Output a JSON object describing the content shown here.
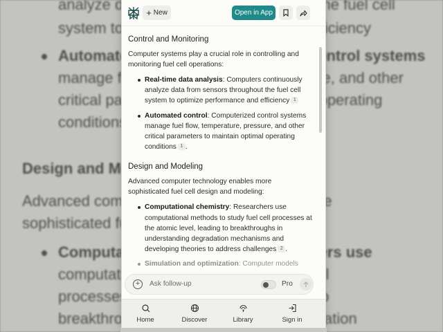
{
  "background": {
    "lines": [
      "analyze data from sensors throughout the fuel cell",
      "system to optimize performance and efficiency",
      "Automated control: Computerized control systems",
      "manage fuel flow, temperature, pressure, and other",
      "critical parameters to maintain optimal operating",
      "conditions",
      "Design and Modeling",
      "Advanced computer technology enables more",
      "sophisticated fuel cell design and modeling:",
      "Computational chemistry: Researchers use",
      "computational methods to study fuel cell",
      "processes at the atomic level, leading to",
      "breakthroughs in understanding degradation"
    ]
  },
  "header": {
    "logo_icon": "perplexity-logo-icon",
    "new_label": "New",
    "open_app_label": "Open in App",
    "bookmark_icon": "bookmark-icon",
    "share_icon": "share-icon"
  },
  "sections": [
    {
      "title": "Control and Monitoring",
      "lead": "Computer systems play a crucial role in controlling and monitoring fuel cell operations:",
      "items": [
        {
          "term": "Real-time data analysis",
          "text": ": Computers continuously analyze data from sensors throughout the fuel cell system to optimize performance and efficiency",
          "cite": "1"
        },
        {
          "term": "Automated control",
          "text": ": Computerized control systems manage fuel flow, temperature, pressure, and other critical parameters to maintain optimal operating conditions",
          "cite": "1",
          "trail": "."
        }
      ]
    },
    {
      "title": "Design and Modeling",
      "lead": "Advanced computer technology enables more sophisticated fuel cell design and modeling:",
      "items": [
        {
          "term": "Computational chemistry",
          "text": ": Researchers use computational methods to study fuel cell processes at the atomic level, leading to breakthroughs in understanding degradation mechanisms and developing theories to address challenges",
          "cite": "2",
          "trail": "."
        },
        {
          "term": "Simulation and optimization",
          "text": ": Computer models",
          "cite": "",
          "trail": ""
        }
      ]
    }
  ],
  "composer": {
    "placeholder": "Ask follow-up",
    "pro_label": "Pro"
  },
  "nav": [
    {
      "label": "Home",
      "icon": "home-search-icon"
    },
    {
      "label": "Discover",
      "icon": "globe-icon"
    },
    {
      "label": "Library",
      "icon": "library-icon"
    },
    {
      "label": "Sign in",
      "icon": "sign-in-icon"
    }
  ],
  "colors": {
    "accent": "#1f8a8a",
    "panel_bg": "#fcfcf9"
  }
}
